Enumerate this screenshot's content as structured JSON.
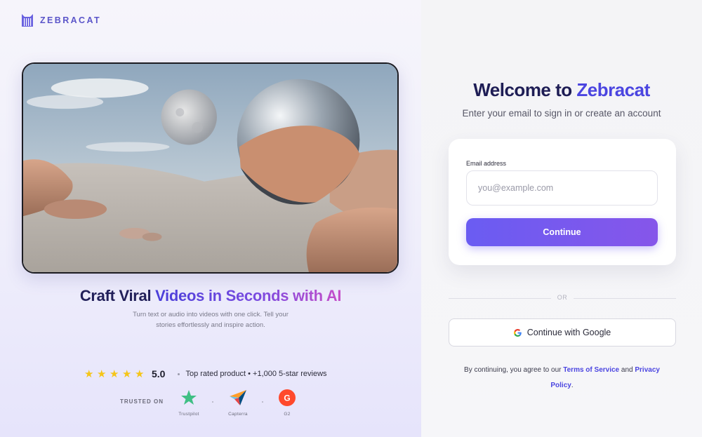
{
  "brand": {
    "name": "ZEBRACAT"
  },
  "hero": {
    "image": "surreal-desert-with-moon-and-mirror-sphere"
  },
  "headline": {
    "part1": "Craft Viral ",
    "part2": "Videos in Seconds with AI"
  },
  "subline": "Turn text or audio into videos with one click. Tell your stories effortlessly and inspire action.",
  "rating": {
    "stars": 5,
    "score": "5.0",
    "text": "Top rated product • +1,000 5-star reviews"
  },
  "trusted": {
    "label": "TRUSTED ON",
    "badges": [
      {
        "name": "Trustpilot",
        "icon": "trustpilot-star-icon"
      },
      {
        "name": "Capterra",
        "icon": "capterra-arrow-icon"
      },
      {
        "name": "G2",
        "icon": "g2-logo-icon"
      }
    ]
  },
  "auth": {
    "title_part1": "Welcome to ",
    "title_part2": "Zebracat",
    "subtitle": "Enter your email to sign in or create an account",
    "email_label": "Email address",
    "email_placeholder": "you@example.com",
    "email_value": "",
    "continue_label": "Continue",
    "or_label": "OR",
    "google_label": "Continue with Google",
    "legal_prefix": "By continuing, you agree to our ",
    "terms_label": "Terms of Service",
    "legal_and": " and ",
    "privacy_label": "Privacy Policy",
    "legal_suffix": "."
  },
  "colors": {
    "accent": "#4b45e0",
    "button_start": "#6a5cf2",
    "button_end": "#8656ea",
    "star": "#f5c518"
  }
}
